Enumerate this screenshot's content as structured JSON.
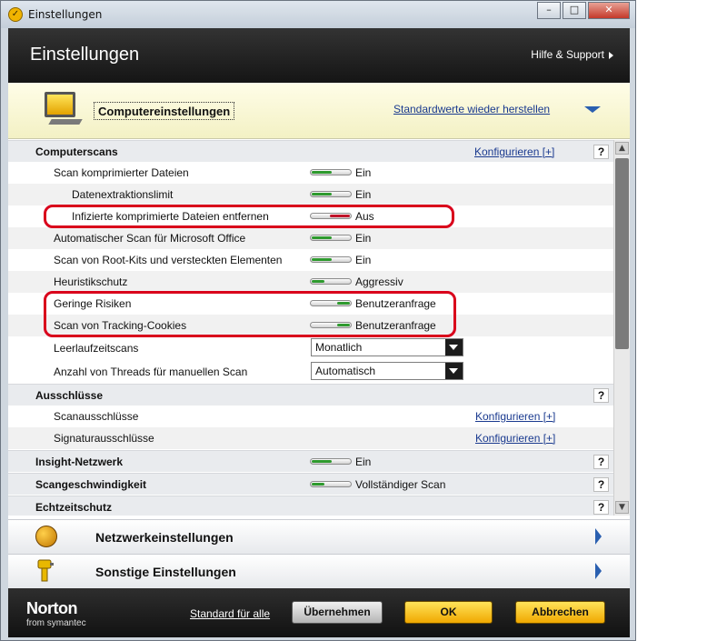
{
  "window": {
    "title": "Einstellungen",
    "controls": {
      "minimize": "–",
      "maximize": "□",
      "close": "✕"
    }
  },
  "header": {
    "title": "Einstellungen",
    "help": "Hilfe & Support"
  },
  "section": {
    "title": "Computereinstellungen",
    "restore_link": "Standardwerte wieder herstellen"
  },
  "groups": {
    "computerscans": {
      "label": "Computerscans",
      "link": "Konfigurieren [+]",
      "help": "?"
    },
    "ausschluesse": {
      "label": "Ausschlüsse",
      "help": "?"
    },
    "insight": {
      "label": "Insight-Netzwerk",
      "value": "Ein",
      "help": "?"
    },
    "scanspeed": {
      "label": "Scangeschwindigkeit",
      "value": "Vollständiger Scan",
      "help": "?"
    },
    "echtzeit": {
      "label": "Echtzeitschutz",
      "help": "?"
    }
  },
  "scan_rows": [
    {
      "label": "Scan komprimierter Dateien",
      "value": "Ein"
    },
    {
      "label": "Datenextraktionslimit",
      "value": "Ein"
    },
    {
      "label": "Infizierte komprimierte Dateien entfernen",
      "value": "Aus"
    },
    {
      "label": "Automatischer Scan für Microsoft Office",
      "value": "Ein"
    },
    {
      "label": "Scan von Root-Kits und versteckten Elementen",
      "value": "Ein"
    },
    {
      "label": "Heuristikschutz",
      "value": "Aggressiv"
    },
    {
      "label": "Geringe Risiken",
      "value": "Benutzeranfrage"
    },
    {
      "label": "Scan von Tracking-Cookies",
      "value": "Benutzeranfrage"
    }
  ],
  "dropdown_rows": [
    {
      "label": "Leerlaufzeitscans",
      "value": "Monatlich"
    },
    {
      "label": "Anzahl von Threads für manuellen Scan",
      "value": "Automatisch"
    }
  ],
  "exclusion_rows": [
    {
      "label": "Scanausschlüsse",
      "link": "Konfigurieren [+]"
    },
    {
      "label": "Signaturausschlüsse",
      "link": "Konfigurieren [+]"
    }
  ],
  "nav": {
    "network": "Netzwerkeinstellungen",
    "other": "Sonstige Einstellungen"
  },
  "footer": {
    "brand": "Norton",
    "brand_sub": "from symantec",
    "standard_all": "Standard für alle",
    "apply": "Übernehmen",
    "ok": "OK",
    "cancel": "Abbrechen"
  },
  "colors": {
    "on": "#2e9a2e",
    "off": "#c0142a",
    "highlight": "#d9001b",
    "link": "#1a3a8f"
  }
}
